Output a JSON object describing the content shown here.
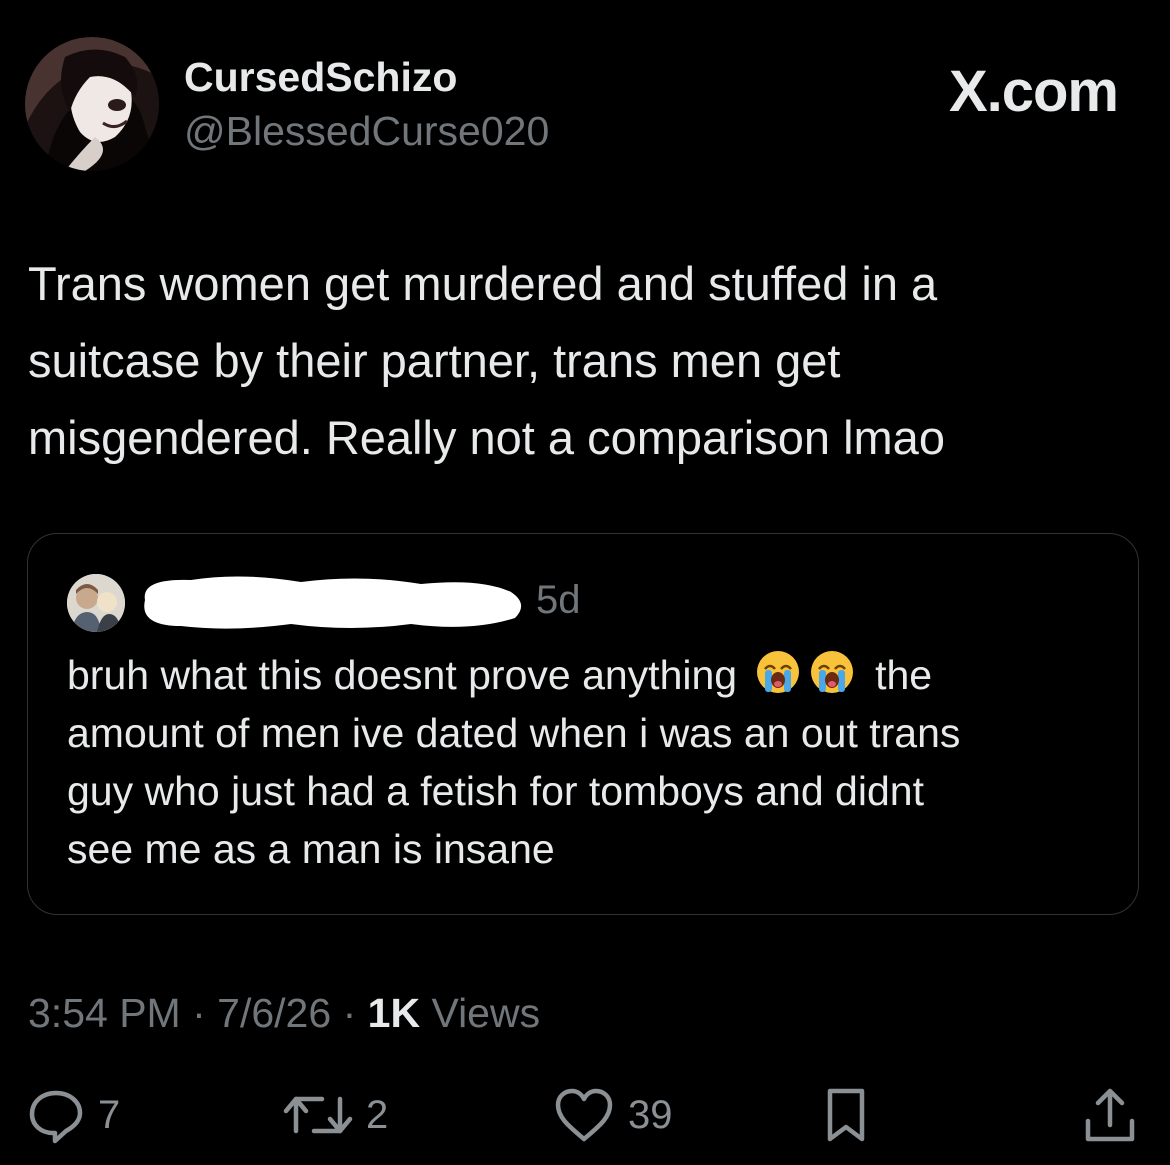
{
  "header": {
    "display_name": "CursedSchizo",
    "handle": "@BlessedCurse020",
    "site_label": "X.com"
  },
  "tweet": {
    "text_lines": [
      "Trans women get murdered and stuffed in a",
      "suitcase by their partner, trans men get",
      "misgendered. Really not a comparison lmao"
    ]
  },
  "quote": {
    "time": "5d",
    "text_lines": [
      {
        "before": "bruh what this doesnt prove anything",
        "emoji": [
          "loudly-crying-face-icon",
          "loudly-crying-face-icon"
        ],
        "after": "the"
      },
      {
        "before": "amount of men ive dated when i was an out trans"
      },
      {
        "before": "guy who just had a fetish for tomboys and didnt"
      },
      {
        "before": "see me as a man is insane"
      }
    ]
  },
  "meta": {
    "time": "3:54 PM",
    "date": "7/6/26",
    "views_count": "1K",
    "views_label": "Views",
    "separator": "·"
  },
  "actions": {
    "replies": "7",
    "reposts": "2",
    "likes": "39"
  },
  "colors": {
    "background": "#000000",
    "text": "#e7e9ea",
    "secondary": "#71767b",
    "border": "#2f3336"
  }
}
